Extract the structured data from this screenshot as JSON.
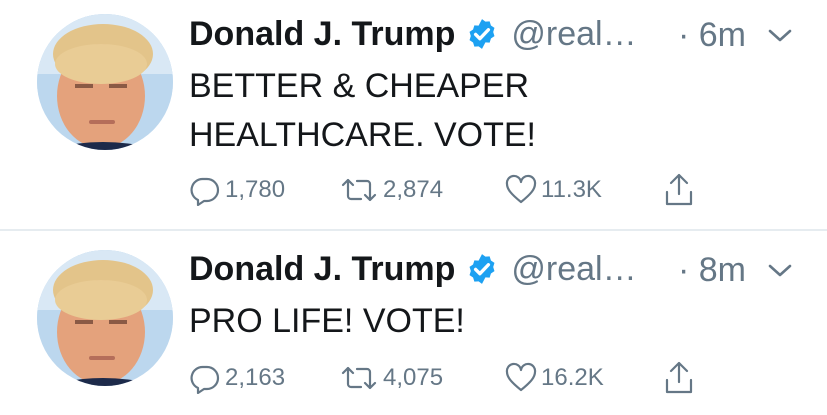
{
  "tweets": [
    {
      "author": "Donald J. Trump",
      "handle": "@real…",
      "time": "· 6m",
      "text_lines": [
        "BETTER & CHEAPER",
        "HEALTHCARE. VOTE!"
      ],
      "replies": "1,780",
      "retweets": "2,874",
      "likes": "11.3K"
    },
    {
      "author": "Donald J. Trump",
      "handle": "@real…",
      "time": "· 8m",
      "text_lines": [
        "PRO LIFE! VOTE!"
      ],
      "replies": "2,163",
      "retweets": "4,075",
      "likes": "16.2K"
    }
  ],
  "icons": {
    "verified": "verified-badge-icon",
    "menu": "chevron-down-icon",
    "reply": "reply-icon",
    "retweet": "retweet-icon",
    "like": "heart-icon",
    "share": "share-icon"
  },
  "colors": {
    "text": "#14171a",
    "secondary": "#657786",
    "verified": "#1da1f2",
    "divider": "#e6ecf0"
  }
}
